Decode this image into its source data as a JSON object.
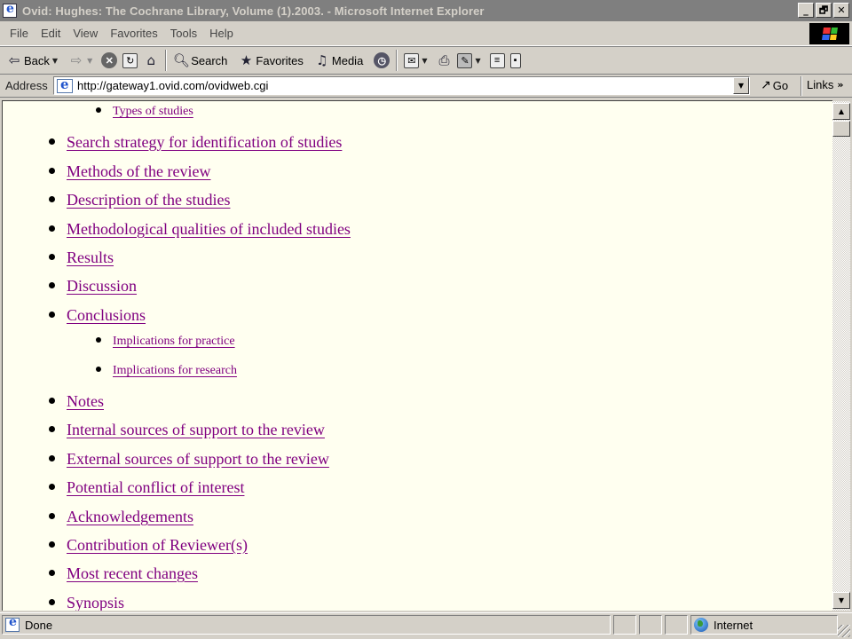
{
  "window": {
    "title": "Ovid: Hughes: The Cochrane Library, Volume (1).2003. - Microsoft Internet Explorer",
    "buttons": [
      "_",
      "🗗",
      "✕"
    ]
  },
  "menu": [
    "File",
    "Edit",
    "View",
    "Favorites",
    "Tools",
    "Help"
  ],
  "toolbar": {
    "back": "Back",
    "search": "Search",
    "favorites": "Favorites",
    "media": "Media"
  },
  "address": {
    "label": "Address",
    "url": "http://gateway1.ovid.com/ovidweb.cgi",
    "go": "Go",
    "links": "Links"
  },
  "toc": [
    {
      "label": "Types of studies",
      "level": 2
    },
    {
      "label": "Search strategy for identification of studies",
      "level": 1
    },
    {
      "label": "Methods of the review",
      "level": 1
    },
    {
      "label": "Description of the studies",
      "level": 1
    },
    {
      "label": "Methodological qualities of included studies",
      "level": 1
    },
    {
      "label": "Results",
      "level": 1
    },
    {
      "label": "Discussion",
      "level": 1
    },
    {
      "label": "Conclusions",
      "level": 1
    },
    {
      "label": "Implications for practice",
      "level": 2
    },
    {
      "label": "Implications for research",
      "level": 2
    },
    {
      "label": "Notes",
      "level": 1
    },
    {
      "label": "Internal sources of support to the review",
      "level": 1
    },
    {
      "label": "External sources of support to the review",
      "level": 1
    },
    {
      "label": "Potential conflict of interest",
      "level": 1
    },
    {
      "label": "Acknowledgements",
      "level": 1
    },
    {
      "label": "Contribution of Reviewer(s)",
      "level": 1
    },
    {
      "label": "Most recent changes",
      "level": 1
    },
    {
      "label": "Synopsis",
      "level": 1
    }
  ],
  "status": {
    "text": "Done",
    "zone": "Internet"
  },
  "colors": {
    "visited_link": "#800080",
    "page_background": "#fffff0"
  }
}
